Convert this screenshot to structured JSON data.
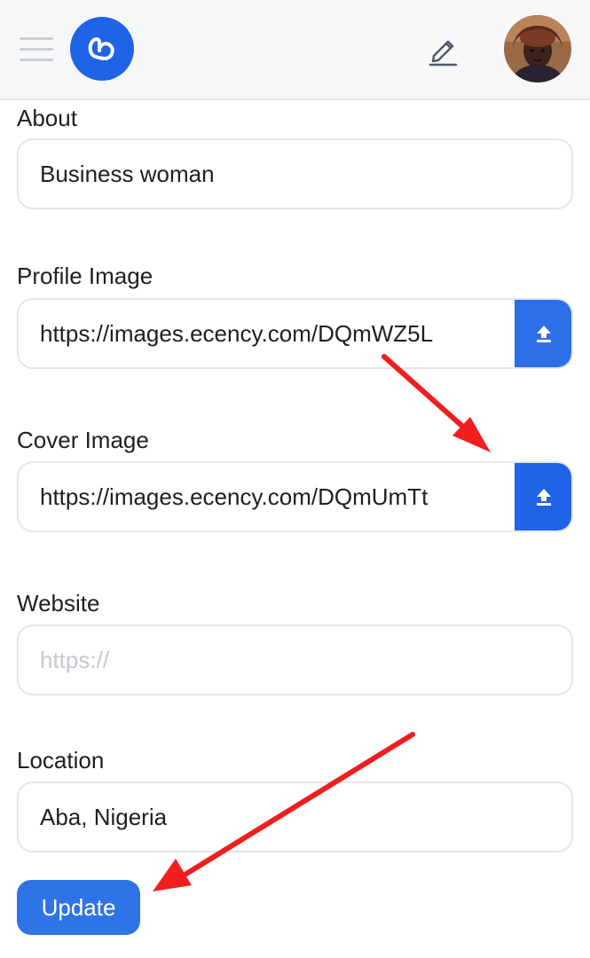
{
  "header": {
    "menu_icon": "hamburger-icon",
    "logo_icon": "ecency-logo",
    "edit_icon": "pencil-icon",
    "avatar": "user-avatar"
  },
  "form": {
    "about": {
      "label": "About",
      "value": "Business woman"
    },
    "profile_image": {
      "label": "Profile Image",
      "value": "https://images.ecency.com/DQmWZ5L",
      "button_icon": "upload-icon"
    },
    "cover_image": {
      "label": "Cover Image",
      "value": "https://images.ecency.com/DQmUmTt",
      "button_icon": "upload-icon"
    },
    "website": {
      "label": "Website",
      "value": "",
      "placeholder": "https://"
    },
    "location": {
      "label": "Location",
      "value": "Aba, Nigeria"
    },
    "update_label": "Update"
  },
  "colors": {
    "accent": "#1f63e6",
    "button": "#2f74e6",
    "annotation_arrow": "#f01e1e"
  }
}
